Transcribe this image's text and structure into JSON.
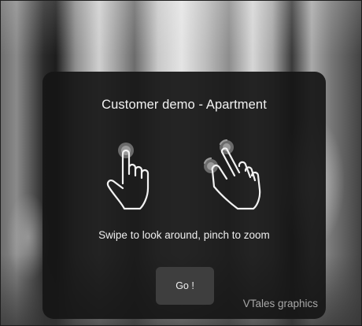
{
  "dialog": {
    "title": "Customer demo - Apartment",
    "hint": "Swipe to look around, pinch to zoom",
    "go_label": "Go !",
    "brand": "VTales graphics"
  },
  "icons": {
    "swipe": "swipe-gesture-icon",
    "pinch": "pinch-gesture-icon"
  },
  "colors": {
    "dialog_background": "#161616",
    "button_background": "#3e3e3e",
    "text": "#ffffff",
    "brand_text": "#a8a8a8"
  }
}
